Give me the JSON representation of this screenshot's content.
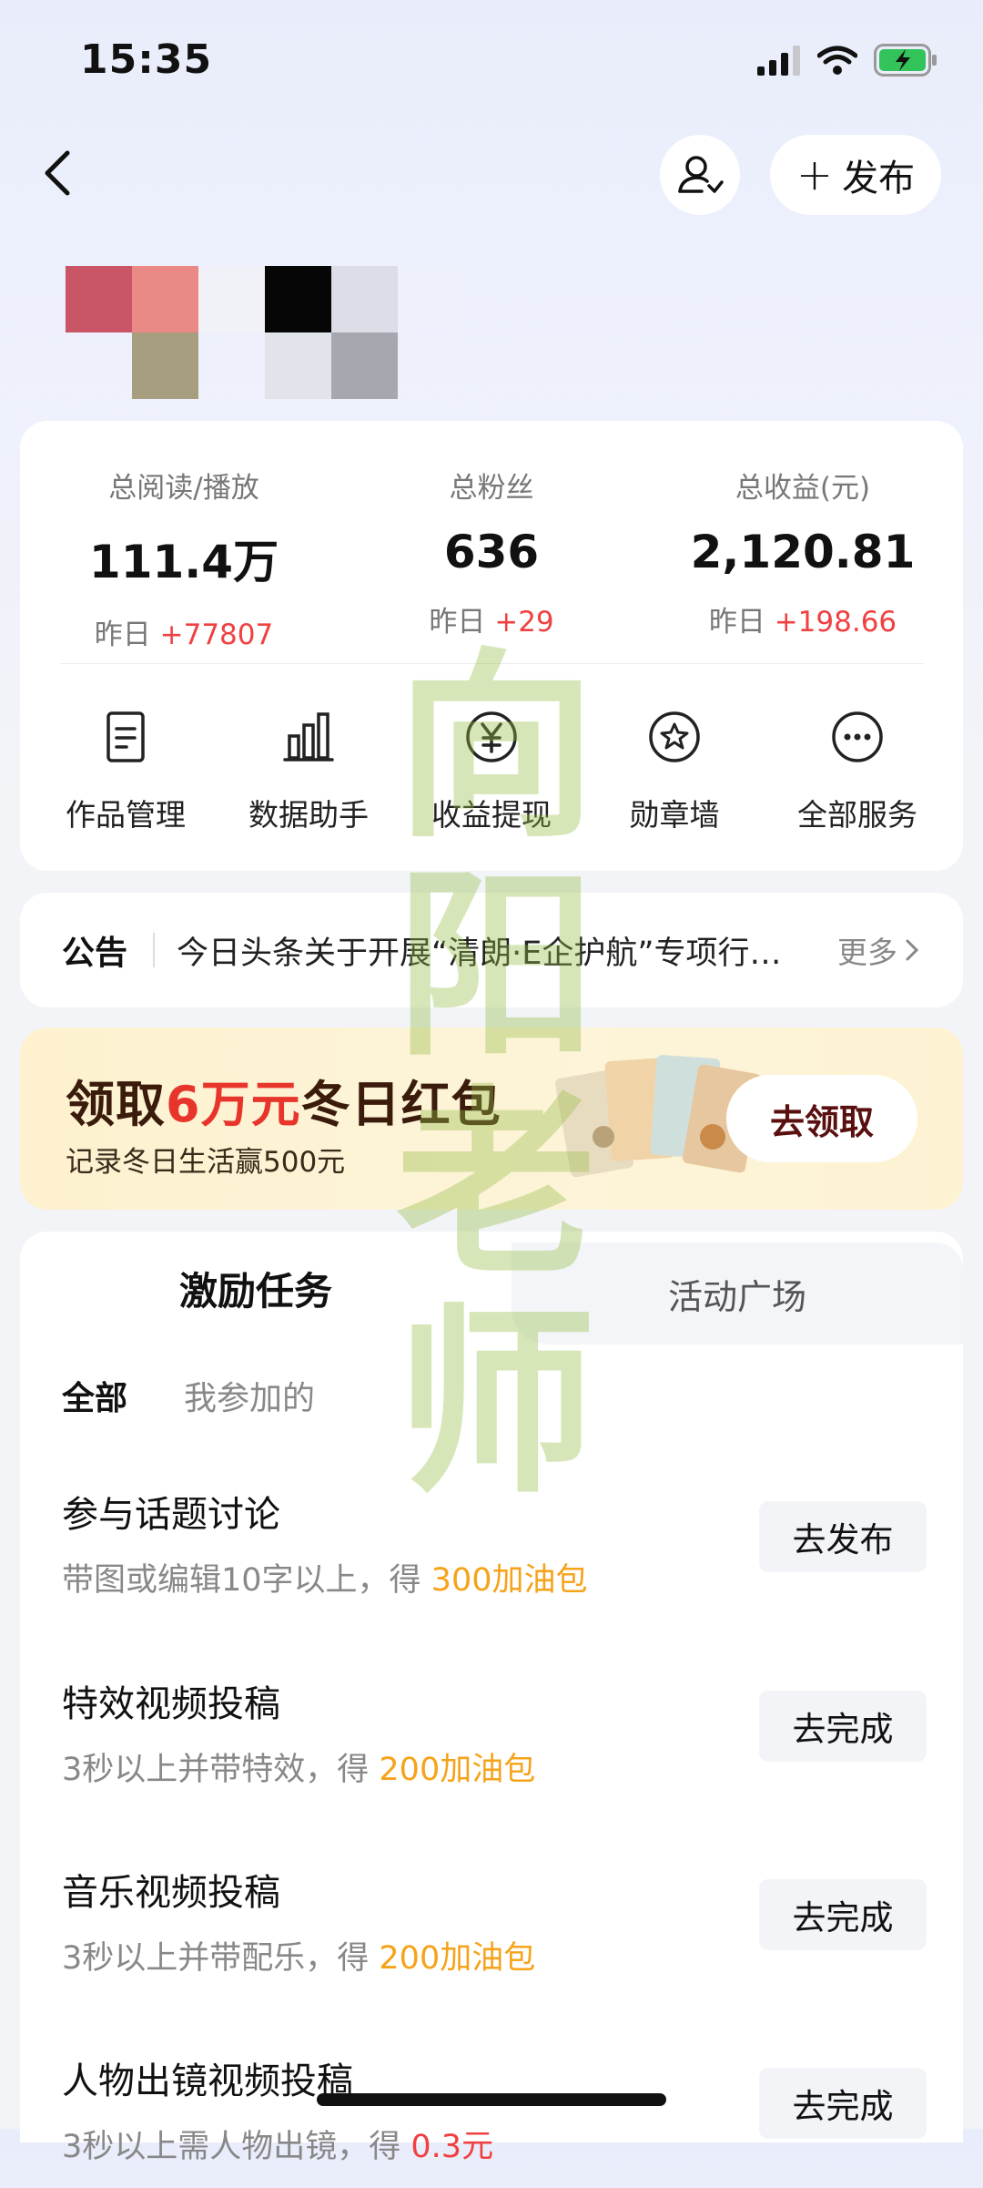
{
  "status_bar": {
    "time": "15:35"
  },
  "nav": {
    "publish_label": "发布"
  },
  "stats": [
    {
      "label": "总阅读/播放",
      "value": "111.4万",
      "yesterday_prefix": "昨日",
      "yesterday_change": "+77807"
    },
    {
      "label": "总粉丝",
      "value": "636",
      "yesterday_prefix": "昨日",
      "yesterday_change": "+29"
    },
    {
      "label": "总收益(元)",
      "value": "2,120.81",
      "yesterday_prefix": "昨日",
      "yesterday_change": "+198.66"
    }
  ],
  "services": [
    {
      "label": "作品管理",
      "icon": "document-icon"
    },
    {
      "label": "数据助手",
      "icon": "bar-chart-icon"
    },
    {
      "label": "收益提现",
      "icon": "yen-icon"
    },
    {
      "label": "勋章墙",
      "icon": "medal-icon"
    },
    {
      "label": "全部服务",
      "icon": "more-icon"
    }
  ],
  "notice": {
    "tag": "公告",
    "text": "今日头条关于开展“清朗·E企护航”专项行动的公告",
    "more": "更多"
  },
  "banner": {
    "title_pre": "领取",
    "title_highlight": "6万元",
    "title_post": "冬日红包",
    "subtitle": "记录冬日生活赢500元",
    "button": "去领取"
  },
  "tasks_section": {
    "tabs": [
      "激励任务",
      "活动广场"
    ],
    "filters": [
      "全部",
      "我参加的"
    ],
    "items": [
      {
        "title": "参与话题讨论",
        "desc": "带图或编辑10字以上，得 ",
        "reward": "300加油包",
        "button": "去发布"
      },
      {
        "title": "特效视频投稿",
        "desc": "3秒以上并带特效，得 ",
        "reward": "200加油包",
        "button": "去完成"
      },
      {
        "title": "音乐视频投稿",
        "desc": "3秒以上并带配乐，得 ",
        "reward": "200加油包",
        "button": "去完成"
      },
      {
        "title": "人物出镜视频投稿",
        "desc": "3秒以上需人物出镜，得 ",
        "reward": "0.3元",
        "button": "去完成"
      }
    ]
  },
  "watermark": "向阳老师",
  "colors": {
    "accent_red": "#f04142",
    "reward_orange": "#f5a31a",
    "banner_red": "#e8352c"
  }
}
